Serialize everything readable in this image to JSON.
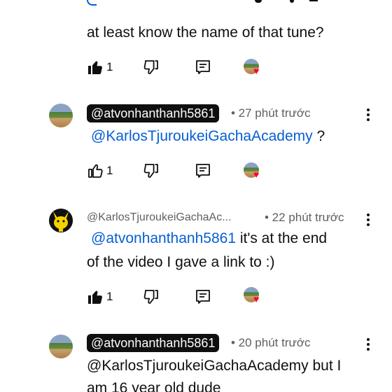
{
  "comments": [
    {
      "author": "",
      "time": "",
      "text_lines": [
        "at least know the name of that tune?"
      ],
      "likes": "1",
      "liked": true
    },
    {
      "author": "@atvonhanthanh5861",
      "time": "• 27 phút trước",
      "mention": "@KarlosTjuroukeiGachaAcademy",
      "text_after": " ?",
      "likes": "1",
      "liked": false
    },
    {
      "author": "@KarlosTjuroukeiGachaAc...",
      "time": "• 22 phút trước",
      "mention": "@atvonhanthanh5861",
      "text_after": "  it's at the end",
      "text_line2": "of the video I gave a link to :)",
      "likes": "1",
      "liked": true
    },
    {
      "author": "@atvonhanthanh5861",
      "time": "• 20 phút trước",
      "text_line1": "@KarlosTjuroukeiGachaAcademy but I",
      "text_line2": "am  16 year old dude"
    }
  ],
  "icons": {
    "like": "thumbs-up-icon",
    "dislike": "thumbs-down-icon",
    "reply": "comment-icon",
    "creator_heart": "creator-heart-icon",
    "more": "more-vertical-icon"
  },
  "colors": {
    "mention": "#065fd4",
    "heart": "#ff0033",
    "chip_bg": "#0f0f0f"
  }
}
